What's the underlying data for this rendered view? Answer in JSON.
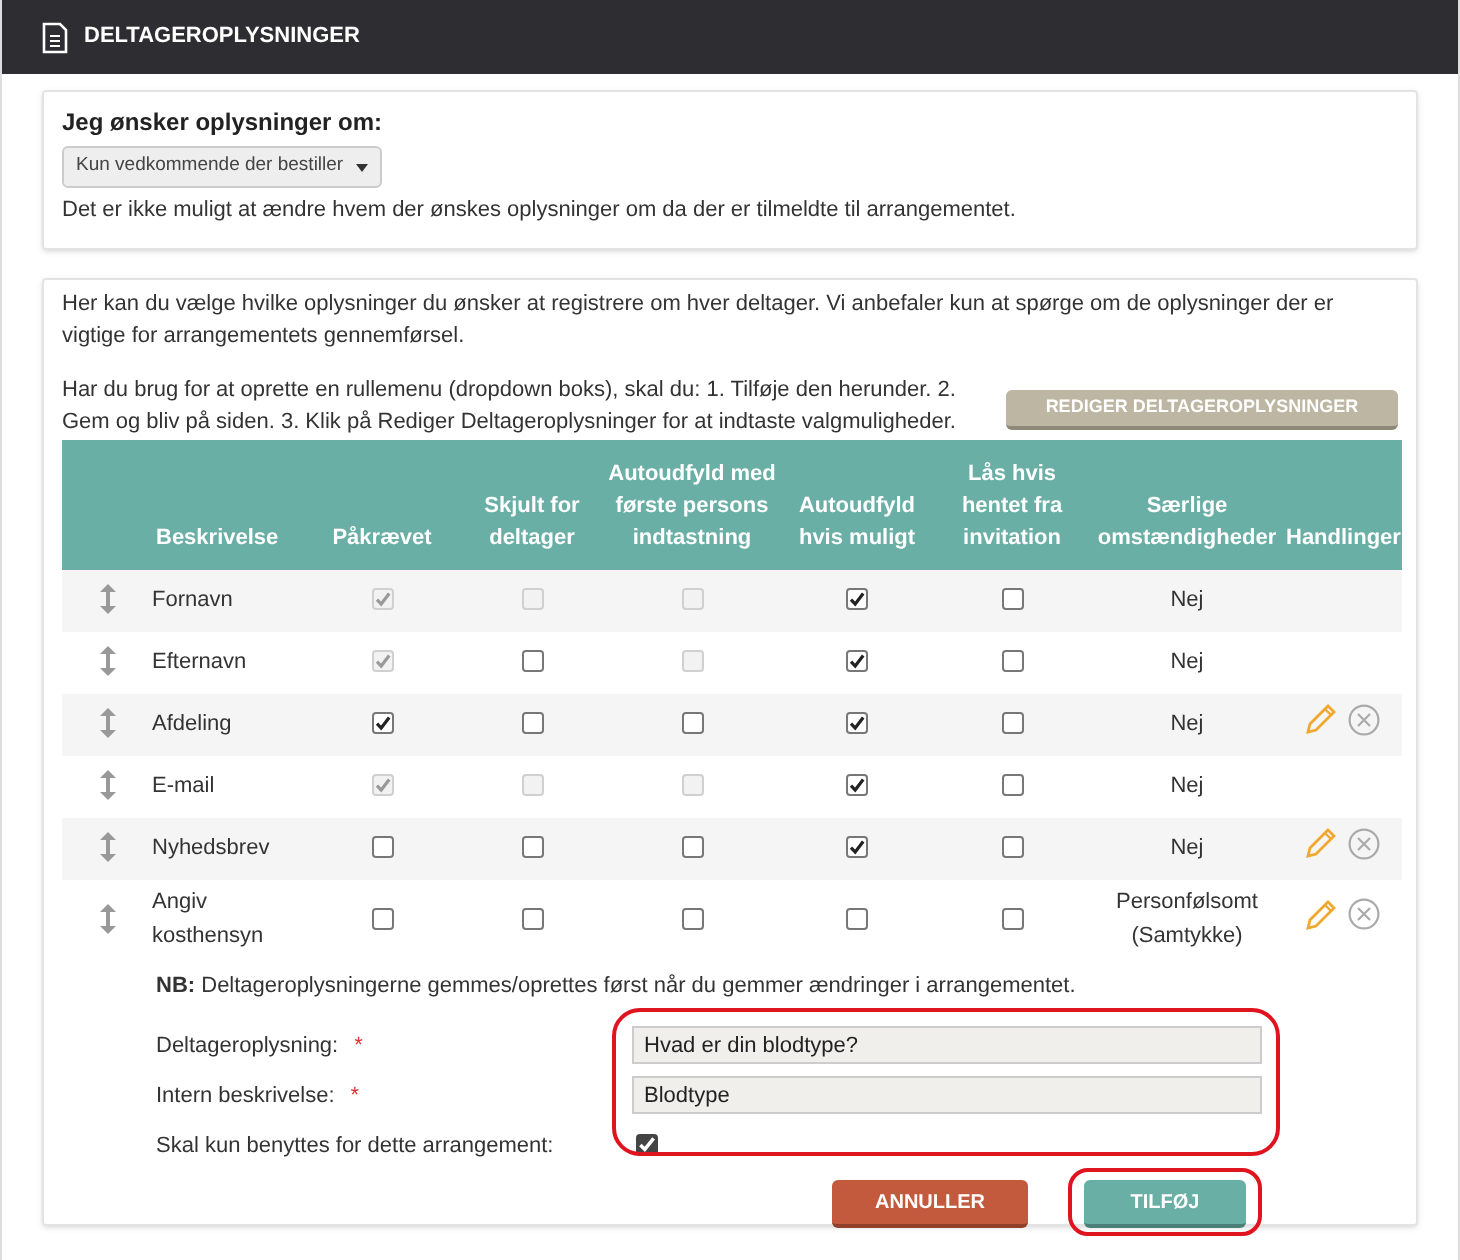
{
  "header": {
    "title": "DELTAGEROPLYSNINGER"
  },
  "scope": {
    "label": "Jeg ønsker oplysninger om:",
    "dropdown": "Kun vedkommende der bestiller",
    "note": "Det er ikke muligt at ændre hvem der ønskes oplysninger om da der er tilmeldte til arrangementet."
  },
  "intro": {
    "text": "Her kan du vælge hvilke oplysninger du ønsker at registrere om hver deltager. Vi anbefaler kun at spørge om de oplysninger der er vigtige for arrangementets gennemførsel.",
    "hint": "Har du brug for at oprette en rullemenu (dropdown boks), skal du: 1. Tilføje den herunder. 2. Gem og bliv på siden. 3. Klik på Rediger Deltageroplysninger for at indtaste valgmuligheder.",
    "edit_button": "REDIGER DELTAGEROPLYSNINGER"
  },
  "table": {
    "columns": [
      "Beskrivelse",
      "Påkrævet",
      "Skjult for deltager",
      "Autoudfyld med første persons indtastning",
      "Autoudfyld hvis muligt",
      "Lås hvis hentet fra invitation",
      "Særlige omstændigheder",
      "Handlinger"
    ],
    "rows": [
      {
        "description": "Fornavn",
        "checks": [
          {
            "checked": true,
            "disabled": true
          },
          {
            "checked": false,
            "disabled": true
          },
          {
            "checked": false,
            "disabled": true
          },
          {
            "checked": true,
            "disabled": false
          },
          {
            "checked": false,
            "disabled": false
          }
        ],
        "special": "Nej",
        "editable": false
      },
      {
        "description": "Efternavn",
        "checks": [
          {
            "checked": true,
            "disabled": true
          },
          {
            "checked": false,
            "disabled": false
          },
          {
            "checked": false,
            "disabled": true
          },
          {
            "checked": true,
            "disabled": false
          },
          {
            "checked": false,
            "disabled": false
          }
        ],
        "special": "Nej",
        "editable": false
      },
      {
        "description": "Afdeling",
        "checks": [
          {
            "checked": true,
            "disabled": false
          },
          {
            "checked": false,
            "disabled": false
          },
          {
            "checked": false,
            "disabled": false
          },
          {
            "checked": true,
            "disabled": false
          },
          {
            "checked": false,
            "disabled": false
          }
        ],
        "special": "Nej",
        "editable": true
      },
      {
        "description": "E-mail",
        "checks": [
          {
            "checked": true,
            "disabled": true
          },
          {
            "checked": false,
            "disabled": true
          },
          {
            "checked": false,
            "disabled": true
          },
          {
            "checked": true,
            "disabled": false
          },
          {
            "checked": false,
            "disabled": false
          }
        ],
        "special": "Nej",
        "editable": false
      },
      {
        "description": "Nyhedsbrev",
        "checks": [
          {
            "checked": false,
            "disabled": false
          },
          {
            "checked": false,
            "disabled": false
          },
          {
            "checked": false,
            "disabled": false
          },
          {
            "checked": true,
            "disabled": false
          },
          {
            "checked": false,
            "disabled": false
          }
        ],
        "special": "Nej",
        "editable": true
      },
      {
        "description": "Angiv kosthensyn",
        "checks": [
          {
            "checked": false,
            "disabled": false
          },
          {
            "checked": false,
            "disabled": false
          },
          {
            "checked": false,
            "disabled": false
          },
          {
            "checked": false,
            "disabled": false
          },
          {
            "checked": false,
            "disabled": false
          }
        ],
        "special": "Personfølsomt (Samtykke)",
        "editable": true
      }
    ]
  },
  "nb": "**NB:** Deltageroplysningerne gemmes/oprettes først når du gemmer ændringer i arrangementet.",
  "form": {
    "highlighted": true,
    "fields": [
      {
        "label": "Deltageroplysning:",
        "required_mark": "*",
        "value": "Hvad er din blodtype?"
      },
      {
        "label": "Intern beskrivelse:",
        "required_mark": "*",
        "value": "Blodtype"
      }
    ],
    "only_this": {
      "label": "Skal kun benyttes for dette arrangement:",
      "checked": true
    }
  },
  "buttons": [
    {
      "kind": "cancel",
      "label": "ANNULLER",
      "highlighted": false
    },
    {
      "kind": "add",
      "label": "TILFØJ",
      "highlighted": true
    }
  ]
}
